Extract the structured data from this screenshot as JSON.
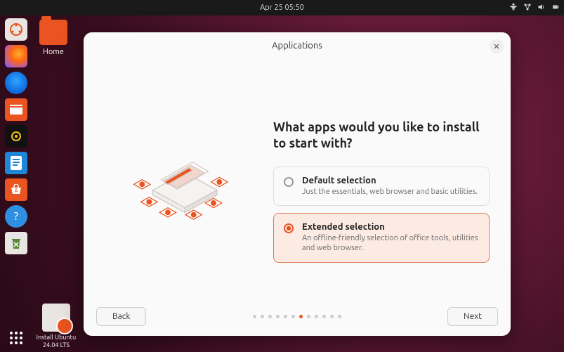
{
  "topbar": {
    "datetime": "Apr 25  05:50"
  },
  "desktop": {
    "home_label": "Home",
    "install_label_line1": "Install Ubuntu",
    "install_label_line2": "24.04 LTS"
  },
  "dock": {
    "items": [
      {
        "name": "installer-running-icon"
      },
      {
        "name": "firefox-icon"
      },
      {
        "name": "thunderbird-icon"
      },
      {
        "name": "files-icon"
      },
      {
        "name": "rhythmbox-icon"
      },
      {
        "name": "libreoffice-icon"
      },
      {
        "name": "ubuntu-software-icon"
      },
      {
        "name": "help-icon"
      },
      {
        "name": "trash-icon"
      }
    ]
  },
  "installer": {
    "title": "Applications",
    "question": "What apps would you like to install to start with?",
    "options": [
      {
        "id": "default",
        "title": "Default selection",
        "desc": "Just the essentials, web browser and basic utilities.",
        "selected": false
      },
      {
        "id": "extended",
        "title": "Extended selection",
        "desc": "An offline-friendly selection of office tools, utilities and web browser.",
        "selected": true
      }
    ],
    "back_label": "Back",
    "next_label": "Next",
    "step_count": 12,
    "active_step": 6
  },
  "colors": {
    "accent": "#e95420"
  }
}
